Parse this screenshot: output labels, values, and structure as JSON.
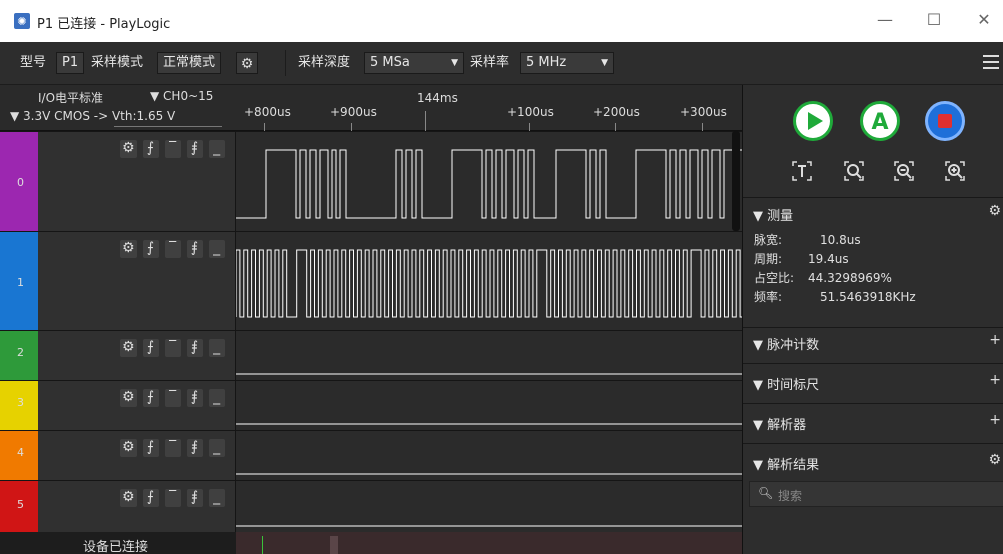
{
  "window": {
    "title": "P1 已连接 - PlayLogic",
    "minimize": "—",
    "maximize": "☐",
    "close": "✕"
  },
  "toolbar": {
    "model_label": "型号",
    "model_value": "P1",
    "sample_mode_label": "采样模式",
    "sample_mode_value": "正常模式",
    "depth_label": "采样深度",
    "depth_value": "5 MSa",
    "rate_label": "采样率",
    "rate_value": "5 MHz"
  },
  "left_header": {
    "io_level": "I/O电平标准",
    "channel_range": "▼ CH0~15",
    "voltage": "▼ 3.3V CMOS -> Vth:1.65 V"
  },
  "ruler": {
    "center": "144ms",
    "ticks": [
      "+800us",
      "+900us",
      "+100us",
      "+200us",
      "+300us"
    ]
  },
  "channels": [
    {
      "num": "0",
      "color": "#9c27b0"
    },
    {
      "num": "1",
      "color": "#1976d2"
    },
    {
      "num": "2",
      "color": "#2e9a3a"
    },
    {
      "num": "3",
      "color": "#e6d200"
    },
    {
      "num": "4",
      "color": "#f07a00"
    },
    {
      "num": "5",
      "color": "#d01515"
    }
  ],
  "status": {
    "text": "设备已连接"
  },
  "right_panel": {
    "measure": {
      "title": "▼ 测量",
      "pulse_width_label": "脉宽:",
      "pulse_width_value": "10.8us",
      "period_label": "周期:",
      "period_value": "19.4us",
      "duty_label": "占空比:",
      "duty_value": "44.3298969%",
      "freq_label": "频率:",
      "freq_value": "51.5463918KHz"
    },
    "pulse_count": "▼ 脉冲计数",
    "time_ruler": "▼ 时间标尺",
    "decoder": "▼ 解析器",
    "decode_result": "▼ 解析结果",
    "search_placeholder": "搜索"
  },
  "colors": {
    "run": "#1faa3a",
    "auto": "#1faa3a",
    "stop": "#1e6fd9"
  }
}
